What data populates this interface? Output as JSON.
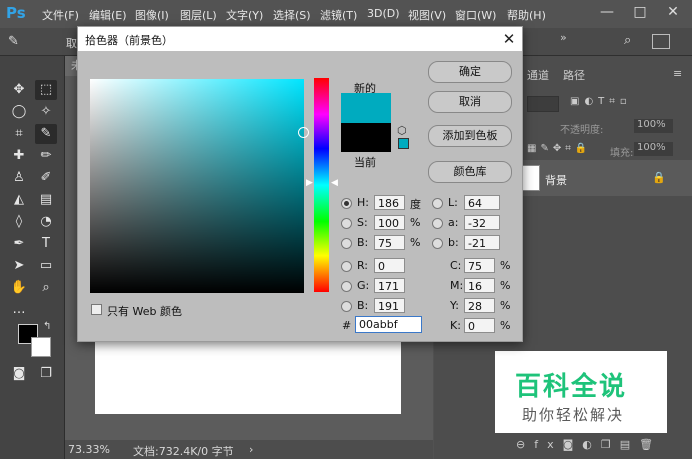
{
  "app": {
    "logo": "Ps"
  },
  "menu": [
    "文件(F)",
    "编辑(E)",
    "图像(I)",
    "图层(L)",
    "文字(Y)",
    "选择(S)",
    "滤镜(T)",
    "3D(D)",
    "视图(V)",
    "窗口(W)",
    "帮助(H)"
  ],
  "window_controls": {
    "minimize": "—",
    "maximize": "□",
    "close": "✕"
  },
  "options_bar": {
    "sample_label": "取样"
  },
  "document": {
    "tab": "未",
    "zoom": "73.33%",
    "doc_info": "文档:732.4K/0 字节",
    "arrow": "›"
  },
  "panels": {
    "tabs": [
      "通道",
      "路径"
    ],
    "opacity_label": "不透明度:",
    "opacity_value": "100%",
    "fill_label": "填充:",
    "fill_value": "100%",
    "layer_name": "背景"
  },
  "dialog": {
    "title": "拾色器（前景色）",
    "close": "✕",
    "new_label": "新的",
    "current_label": "当前",
    "buttons": {
      "ok": "确定",
      "cancel": "取消",
      "add_swatch": "添加到色板",
      "library": "颜色库"
    },
    "fields": {
      "H": {
        "label": "H:",
        "value": "186",
        "unit": "度"
      },
      "S": {
        "label": "S:",
        "value": "100",
        "unit": "%"
      },
      "Bv": {
        "label": "B:",
        "value": "75",
        "unit": "%"
      },
      "R": {
        "label": "R:",
        "value": "0"
      },
      "G": {
        "label": "G:",
        "value": "171"
      },
      "Bc": {
        "label": "B:",
        "value": "191"
      },
      "L": {
        "label": "L:",
        "value": "64"
      },
      "a": {
        "label": "a:",
        "value": "-32"
      },
      "b": {
        "label": "b:",
        "value": "-21"
      },
      "C": {
        "label": "C:",
        "value": "75",
        "unit": "%"
      },
      "M": {
        "label": "M:",
        "value": "16",
        "unit": "%"
      },
      "Y": {
        "label": "Y:",
        "value": "28",
        "unit": "%"
      },
      "K": {
        "label": "K:",
        "value": "0",
        "unit": "%"
      }
    },
    "web_only_label": "只有 Web 颜色",
    "hex_label": "#",
    "hex_value": "00abbf",
    "new_color": "#00abbf",
    "current_color": "#000000"
  },
  "watermark": {
    "title": "百科全说",
    "subtitle": "助你轻松解决"
  }
}
